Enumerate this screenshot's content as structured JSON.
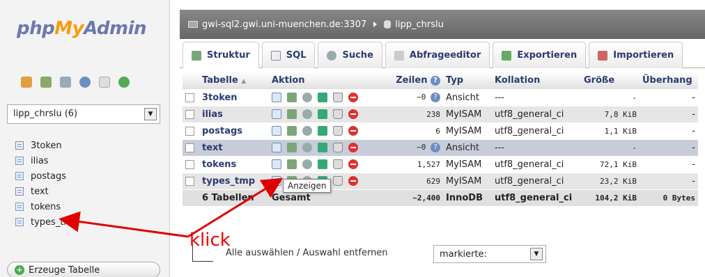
{
  "logo": {
    "php": "php",
    "my": "My",
    "admin": "Admin"
  },
  "sidebar": {
    "db_select": "lipp_chrslu (6)",
    "tables": [
      {
        "name": "3token",
        "kind": "view"
      },
      {
        "name": "ilias",
        "kind": "table"
      },
      {
        "name": "postags",
        "kind": "table"
      },
      {
        "name": "text",
        "kind": "view"
      },
      {
        "name": "tokens",
        "kind": "table"
      },
      {
        "name": "types_tmp",
        "kind": "table"
      }
    ],
    "create_label": "Erzeuge Tabelle"
  },
  "breadcrumb": {
    "server": "gwi-sql2.gwi.uni-muenchen.de:3307",
    "database": "lipp_chrslu"
  },
  "tabs": [
    "Struktur",
    "SQL",
    "Suche",
    "Abfrageeditor",
    "Exportieren",
    "Importieren"
  ],
  "table": {
    "headers": {
      "table": "Tabelle",
      "action": "Aktion",
      "rows": "Zeilen",
      "type": "Typ",
      "collation": "Kollation",
      "size": "Größe",
      "overhead": "Überhang"
    },
    "rows": [
      {
        "name": "3token",
        "rows": "~0",
        "type": "Ansicht",
        "collation": "---",
        "size": "-",
        "overhead": "-"
      },
      {
        "name": "ilias",
        "rows": "238",
        "type": "MyISAM",
        "collation": "utf8_general_ci",
        "size": "7,8 KiB",
        "overhead": "-"
      },
      {
        "name": "postags",
        "rows": "6",
        "type": "MyISAM",
        "collation": "utf8_general_ci",
        "size": "1,1 KiB",
        "overhead": "-"
      },
      {
        "name": "text",
        "rows": "~0",
        "type": "Ansicht",
        "collation": "---",
        "size": "-",
        "overhead": "-"
      },
      {
        "name": "tokens",
        "rows": "1,527",
        "type": "MyISAM",
        "collation": "utf8_general_ci",
        "size": "72,1 KiB",
        "overhead": "-"
      },
      {
        "name": "types_tmp",
        "rows": "629",
        "type": "MyISAM",
        "collation": "utf8_general_ci",
        "size": "23,2 KiB",
        "overhead": "-"
      }
    ],
    "summary": {
      "count": "6 Tabellen",
      "label": "Gesamt",
      "rows": "~2,400",
      "type": "InnoDB",
      "collation": "utf8_general_ci",
      "size": "104,2 KiB",
      "overhead": "0 Bytes"
    }
  },
  "tooltip": "Anzeigen",
  "bottom": {
    "select_all": "Alle auswählen / Auswahl entfernen",
    "marked": "markierte:"
  },
  "annotation": {
    "text": "klick",
    "color": "#e00000"
  }
}
